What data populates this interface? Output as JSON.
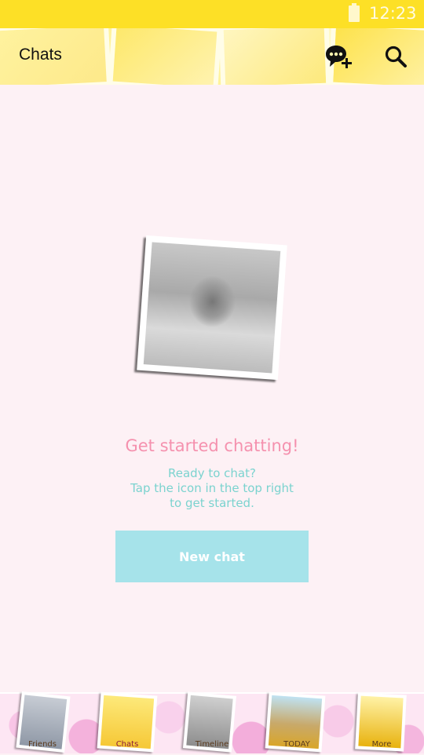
{
  "status_bar": {
    "time": "12:23"
  },
  "header": {
    "title": "Chats",
    "new_chat_icon": "chat-plus-icon",
    "search_icon": "search-icon"
  },
  "empty_state": {
    "headline": "Get started chatting!",
    "line1": "Ready to chat?",
    "line2": "Tap the icon in the top right",
    "line3": "to get started.",
    "button_label": "New chat"
  },
  "tabs": [
    {
      "label": "Friends"
    },
    {
      "label": "Chats"
    },
    {
      "label": "Timeline"
    },
    {
      "label": "TODAY"
    },
    {
      "label": "More"
    }
  ],
  "colors": {
    "status_bar": "#fde026",
    "accent_pink": "#f591ae",
    "accent_teal": "#7bd3cf",
    "button_bg": "#a6e3ea",
    "background": "#fdf1f5"
  }
}
